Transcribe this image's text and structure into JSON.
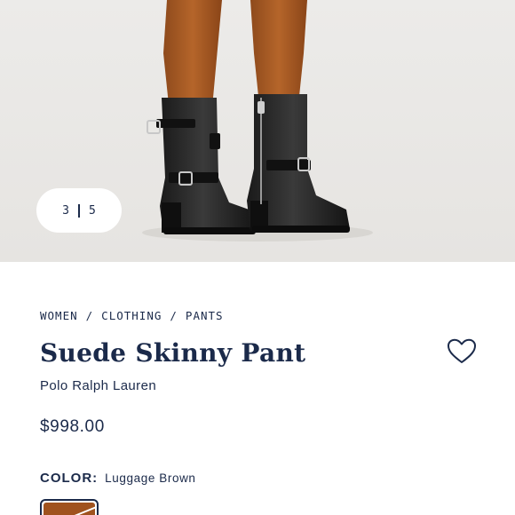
{
  "gallery": {
    "current": "3",
    "total": "5"
  },
  "breadcrumb": [
    "WOMEN",
    "/",
    "CLOTHING",
    "/",
    "PANTS"
  ],
  "product": {
    "title": "Suede Skinny Pant",
    "brand": "Polo Ralph Lauren",
    "price": "$998.00"
  },
  "color": {
    "label": "COLOR:",
    "value": "Luggage Brown",
    "swatch_hex": "#a0521e"
  },
  "icons": {
    "favorite": "heart-outline-icon"
  },
  "theme": {
    "text": "#1b2a4a",
    "background": "#ffffff",
    "hero_background": "#e9e8e6"
  }
}
